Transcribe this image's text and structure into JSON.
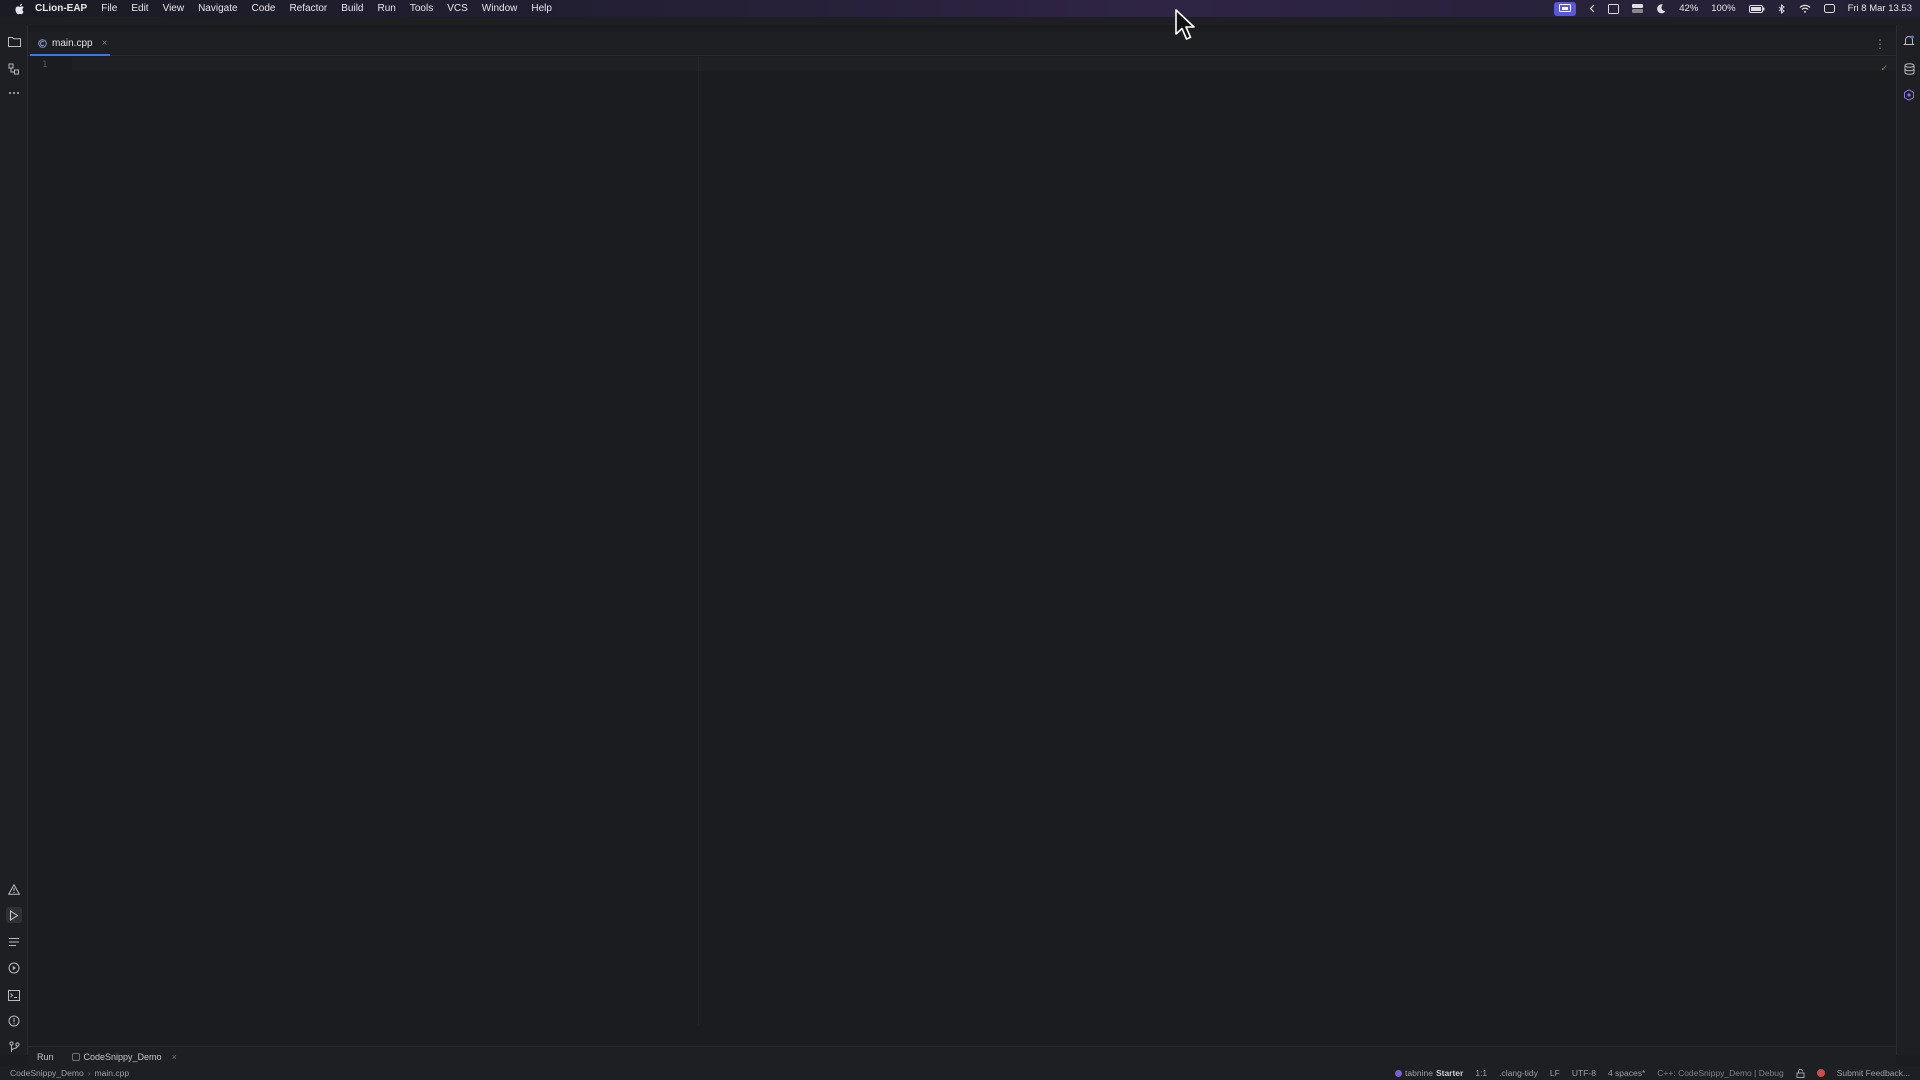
{
  "menubar": {
    "app_name": "CLion-EAP",
    "items": [
      "File",
      "Edit",
      "View",
      "Navigate",
      "Code",
      "Refactor",
      "Build",
      "Run",
      "Tools",
      "VCS",
      "Window",
      "Help"
    ],
    "status": {
      "battery_small": "42%",
      "battery_main": "100%",
      "clock": "Fri 8 Mar  13.53"
    }
  },
  "editor": {
    "tab_label": "main.cpp",
    "tab_close": "×",
    "line_number": "1",
    "inspection_mark": "✓"
  },
  "runbar": {
    "run_label": "Run",
    "config_label": "CodeSnippy_Demo",
    "config_close": "×"
  },
  "statusbar": {
    "breadcrumb_project": "CodeSnippy_Demo",
    "breadcrumb_sep": "›",
    "breadcrumb_file": "main.cpp",
    "tabnine_label": "tabnine",
    "tabnine_plan": "Starter",
    "caret": "1:1",
    "linter": ".clang-tidy",
    "line_ending": "LF",
    "encoding": "UTF-8",
    "indent": "4 spaces*",
    "context": "C++: CodeSnippy_Demo | Debug",
    "feedback": "Submit Feedback..."
  },
  "icons": {
    "left_top": [
      "folder-icon",
      "structure-icon",
      "more-icon"
    ],
    "left_bottom": [
      "problems-icon",
      "run-icon",
      "todo-icon",
      "services-icon",
      "terminal-icon",
      "info-icon",
      "git-icon"
    ],
    "right": [
      "notifications-icon",
      "database-icon",
      "plugin-icon"
    ]
  }
}
